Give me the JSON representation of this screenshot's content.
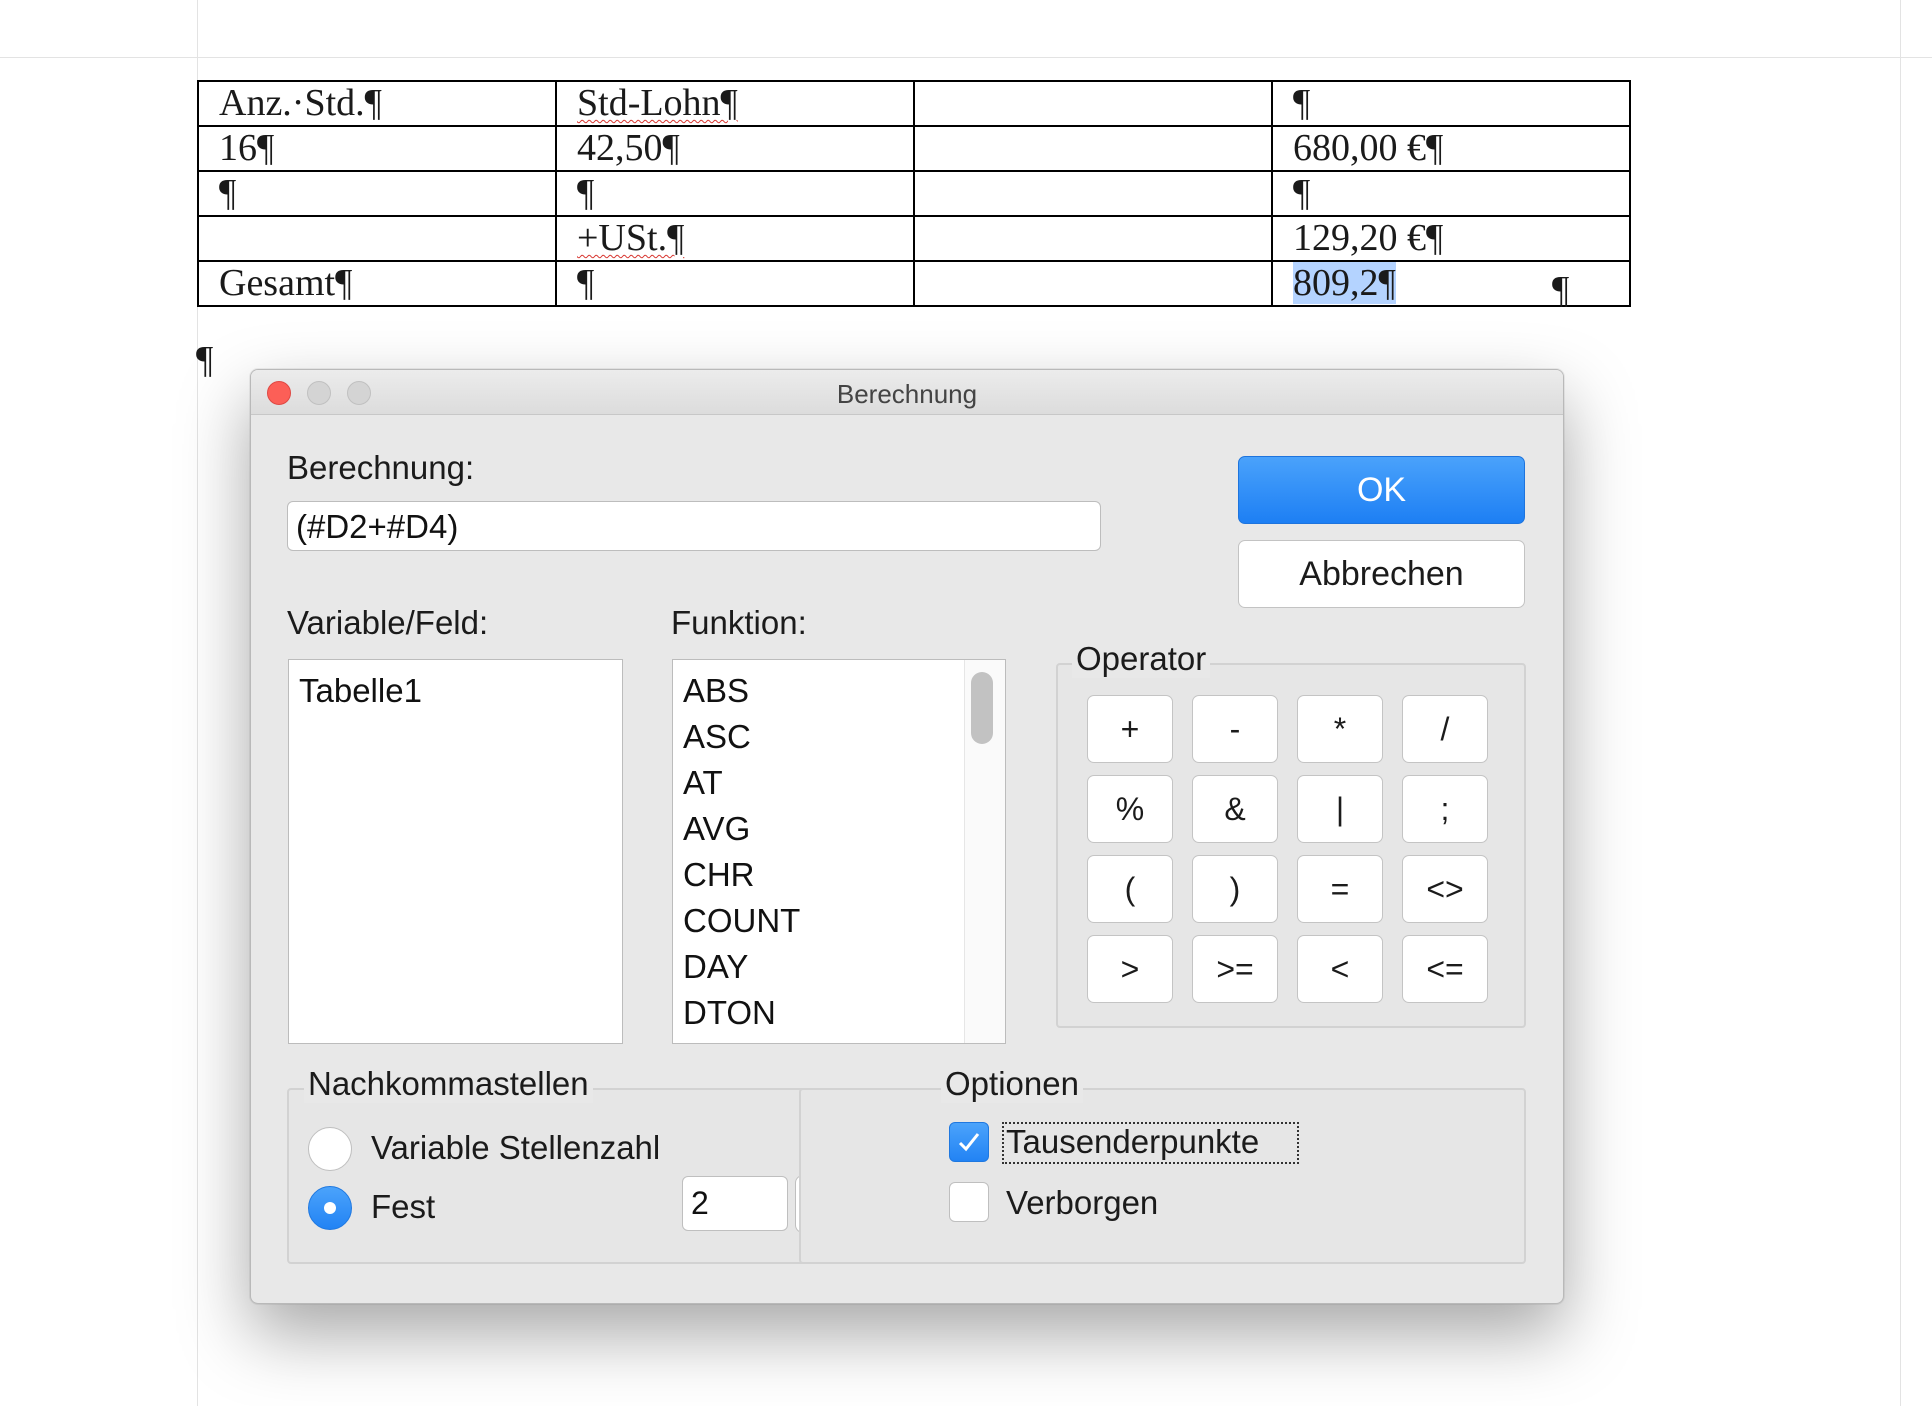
{
  "document": {
    "table_rows": [
      [
        "Anz.·Std.¶",
        "Std-Lohn¶",
        "",
        "¶"
      ],
      [
        "16¶",
        "42,50¶",
        "",
        "680,00 €¶"
      ],
      [
        "¶",
        "¶",
        "",
        "¶"
      ],
      [
        "",
        "+USt.¶",
        "",
        "129,20 €¶"
      ],
      [
        "Gesamt¶",
        "¶",
        "",
        "809,2¶"
      ]
    ],
    "row_end_mark": "¶",
    "after_table_mark": "¶"
  },
  "dialog": {
    "title": "Berechnung",
    "formula_label": "Berechnung:",
    "formula_value": "(#D2+#D4)",
    "ok_label": "OK",
    "cancel_label": "Abbrechen",
    "variable_label": "Variable/Feld:",
    "variable_items": [
      "Tabelle1"
    ],
    "function_label": "Funktion:",
    "function_items": [
      "ABS",
      "ASC",
      "AT",
      "AVG",
      "CHR",
      "COUNT",
      "DAY",
      "DTON"
    ],
    "operator_title": "Operator",
    "operators": [
      "+",
      "-",
      "*",
      "/",
      "%",
      "&",
      "|",
      ";",
      "(",
      ")",
      "=",
      "<>",
      ">",
      ">=",
      "<",
      "<="
    ],
    "decimals_title": "Nachkommastellen",
    "radio_variable_label": "Variable Stellenzahl",
    "radio_fixed_label": "Fest",
    "radio_selected": "Fest",
    "decimals_value": "2",
    "options_title": "Optionen",
    "check_thousands_label": "Tausenderpunkte",
    "check_thousands_checked": true,
    "check_hidden_label": "Verborgen",
    "check_hidden_checked": false
  },
  "colors": {
    "accent": "#2283f4",
    "close_button": "#fc5f57",
    "selection": "#b4d3ff"
  }
}
